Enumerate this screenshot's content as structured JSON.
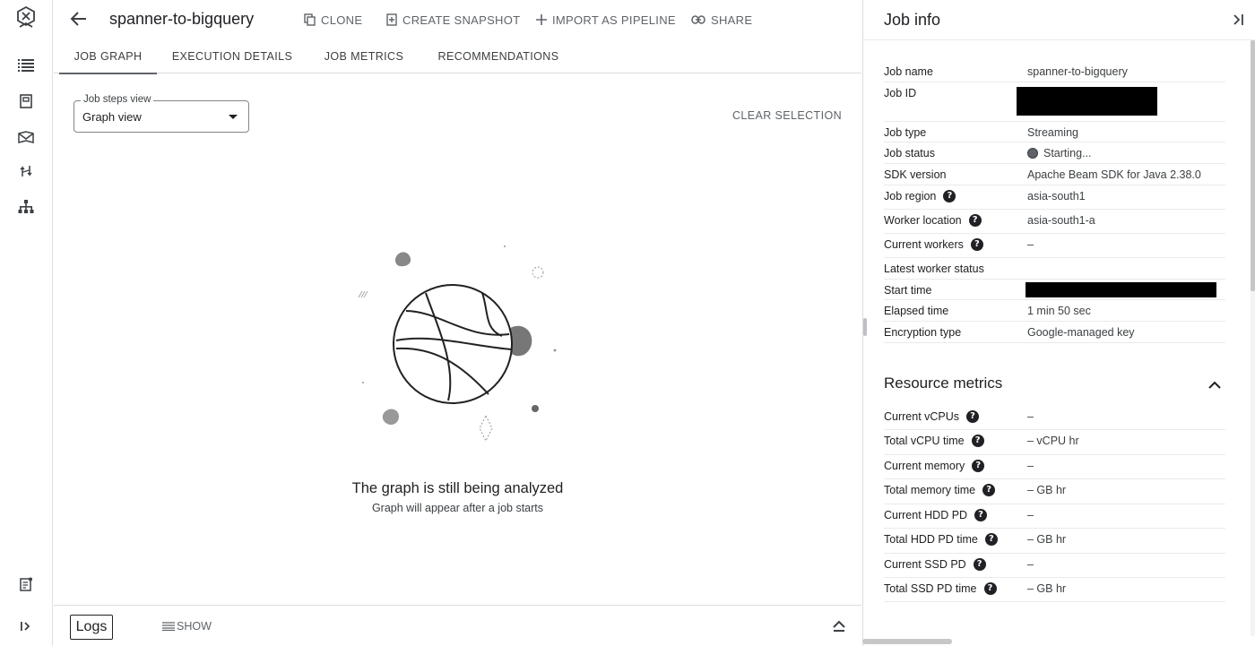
{
  "rail": {
    "top_icons": [
      "dataflow-logo-icon",
      "list-icon",
      "notebook-icon",
      "map-icon",
      "pipeline-icon",
      "hierarchy-icon"
    ],
    "bottom_icons": [
      "release-notes-icon",
      "expand-rail-icon"
    ]
  },
  "header": {
    "title": "spanner-to-bigquery",
    "actions": {
      "clone": "CLONE",
      "snapshot": "CREATE SNAPSHOT",
      "import": "IMPORT AS PIPELINE",
      "share": "SHARE"
    }
  },
  "tabs": [
    {
      "label": "JOB GRAPH",
      "active": true
    },
    {
      "label": "EXECUTION DETAILS",
      "active": false
    },
    {
      "label": "JOB METRICS",
      "active": false
    },
    {
      "label": "RECOMMENDATIONS",
      "active": false
    }
  ],
  "graph": {
    "steps_view_label": "Job steps view",
    "steps_view_value": "Graph view",
    "clear_selection": "CLEAR SELECTION",
    "empty_title": "The graph is still being analyzed",
    "empty_subtitle": "Graph will appear after a job starts"
  },
  "logs": {
    "label": "Logs",
    "show": "SHOW"
  },
  "job_info": {
    "title": "Job info",
    "rows": [
      {
        "key": "Job name",
        "value": "spanner-to-bigquery"
      },
      {
        "key": "Job ID",
        "value": ""
      },
      {
        "key": "Job type",
        "value": "Streaming"
      },
      {
        "key": "Job status",
        "value": "Starting..."
      },
      {
        "key": "SDK version",
        "value": "Apache Beam SDK for Java 2.38.0"
      },
      {
        "key": "Job region",
        "value": "asia-south1"
      },
      {
        "key": "Worker location",
        "value": "asia-south1-a"
      },
      {
        "key": "Current workers",
        "value": "–"
      },
      {
        "key": "Latest worker status",
        "value": ""
      },
      {
        "key": "Start time",
        "value": ""
      },
      {
        "key": "Elapsed time",
        "value": "1 min 50 sec"
      },
      {
        "key": "Encryption type",
        "value": "Google-managed key"
      }
    ]
  },
  "resource_metrics": {
    "title": "Resource metrics",
    "rows": [
      {
        "key": "Current vCPUs",
        "value": "–"
      },
      {
        "key": "Total vCPU time",
        "value": "– vCPU hr"
      },
      {
        "key": "Current memory",
        "value": "–"
      },
      {
        "key": "Total memory time",
        "value": "– GB hr"
      },
      {
        "key": "Current HDD PD",
        "value": "–"
      },
      {
        "key": "Total HDD PD time",
        "value": "– GB hr"
      },
      {
        "key": "Current SSD PD",
        "value": "–"
      },
      {
        "key": "Total SSD PD time",
        "value": "– GB hr"
      }
    ]
  }
}
